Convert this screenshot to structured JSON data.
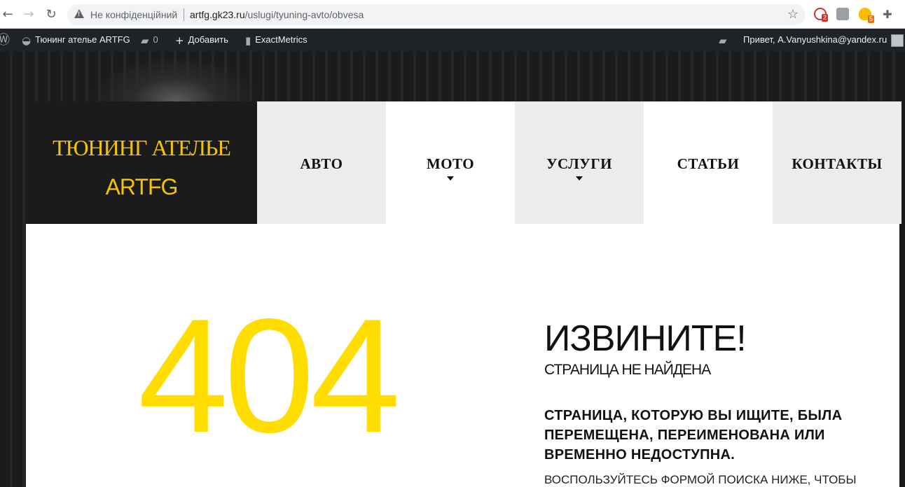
{
  "browser": {
    "security_label": "Не конфіденційний",
    "url_host": "artfg.gk23.ru",
    "url_path": "/uslugi/tyuning-avto/obvesa",
    "extensions": [
      {
        "icon": "ext-red-icon",
        "badge": "2"
      },
      {
        "icon": "ext-gray-icon",
        "badge": ""
      },
      {
        "icon": "ext-bulb-icon",
        "badge": "5"
      },
      {
        "icon": "puzzle-icon",
        "badge": ""
      }
    ]
  },
  "adminbar": {
    "site_name": "Тюнинг ателье ARTFG",
    "comments_count": "0",
    "add_label": "Добавить",
    "metrics_label": "ExactMetrics",
    "greeting": "Привет, A.Vanyushkina@yandex.ru"
  },
  "header": {
    "brand_line1": "ТЮНИНГ АТЕЛЬЕ",
    "brand_line2": "ARTFG",
    "menu": [
      {
        "label": "АВТО",
        "has_submenu": false
      },
      {
        "label": "МОТО",
        "has_submenu": true
      },
      {
        "label": "УСЛУГИ",
        "has_submenu": true
      },
      {
        "label": "СТАТЬИ",
        "has_submenu": false
      },
      {
        "label": "КОНТАКТЫ",
        "has_submenu": false
      }
    ]
  },
  "error": {
    "code": "404",
    "title": "ИЗВИНИТЕ!",
    "subtitle": "СТРАНИЦА НЕ НАЙДЕНА",
    "message": "СТРАНИЦА, КОТОРУЮ ВЫ ИЩИТЕ, БЫЛА ПЕРЕМЕЩЕНА, ПЕРЕИМЕНОВАНА ИЛИ ВРЕМЕННО НЕДОСТУПНА.",
    "hint": "ВОСПОЛЬЗУЙТЕСЬ ФОРМОЙ ПОИСКА НИЖЕ, ЧТОБЫ"
  },
  "colors": {
    "accent": "#ffdd00",
    "brand_bg": "#1b1b1b",
    "admin_bar": "#1d2327"
  }
}
